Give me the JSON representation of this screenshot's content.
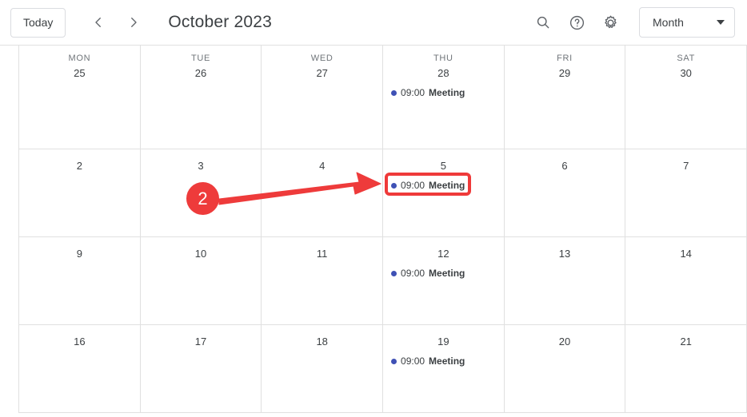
{
  "toolbar": {
    "today_label": "Today",
    "prev_icon": "chevron-left-icon",
    "next_icon": "chevron-right-icon",
    "month_title": "October 2023",
    "search_icon": "search-icon",
    "help_icon": "help-circle-icon",
    "settings_icon": "gear-icon",
    "view_label": "Month"
  },
  "calendar": {
    "day_names": [
      "MON",
      "TUE",
      "WED",
      "THU",
      "FRI",
      "SAT"
    ],
    "weeks": [
      {
        "days": [
          {
            "date": "25",
            "events": []
          },
          {
            "date": "26",
            "events": []
          },
          {
            "date": "27",
            "events": []
          },
          {
            "date": "28",
            "events": [
              {
                "time": "09:00",
                "title": "Meeting",
                "color": "#3f51b5"
              }
            ]
          },
          {
            "date": "29",
            "events": []
          },
          {
            "date": "30",
            "events": []
          }
        ]
      },
      {
        "days": [
          {
            "date": "2",
            "events": []
          },
          {
            "date": "3",
            "events": []
          },
          {
            "date": "4",
            "events": []
          },
          {
            "date": "5",
            "events": [
              {
                "time": "09:00",
                "title": "Meeting",
                "color": "#3f51b5"
              }
            ]
          },
          {
            "date": "6",
            "events": []
          },
          {
            "date": "7",
            "events": []
          }
        ]
      },
      {
        "days": [
          {
            "date": "9",
            "events": []
          },
          {
            "date": "10",
            "events": []
          },
          {
            "date": "11",
            "events": []
          },
          {
            "date": "12",
            "events": [
              {
                "time": "09:00",
                "title": "Meeting",
                "color": "#3f51b5"
              }
            ]
          },
          {
            "date": "13",
            "events": []
          },
          {
            "date": "14",
            "events": []
          }
        ]
      },
      {
        "days": [
          {
            "date": "16",
            "events": []
          },
          {
            "date": "17",
            "events": []
          },
          {
            "date": "18",
            "events": []
          },
          {
            "date": "19",
            "events": [
              {
                "time": "09:00",
                "title": "Meeting",
                "color": "#3f51b5"
              }
            ]
          },
          {
            "date": "20",
            "events": []
          },
          {
            "date": "21",
            "events": []
          }
        ]
      }
    ]
  },
  "annotation": {
    "step_number": "2",
    "accent_color": "#ee3b3b",
    "arrow_icon": "arrow-right-annotation"
  }
}
